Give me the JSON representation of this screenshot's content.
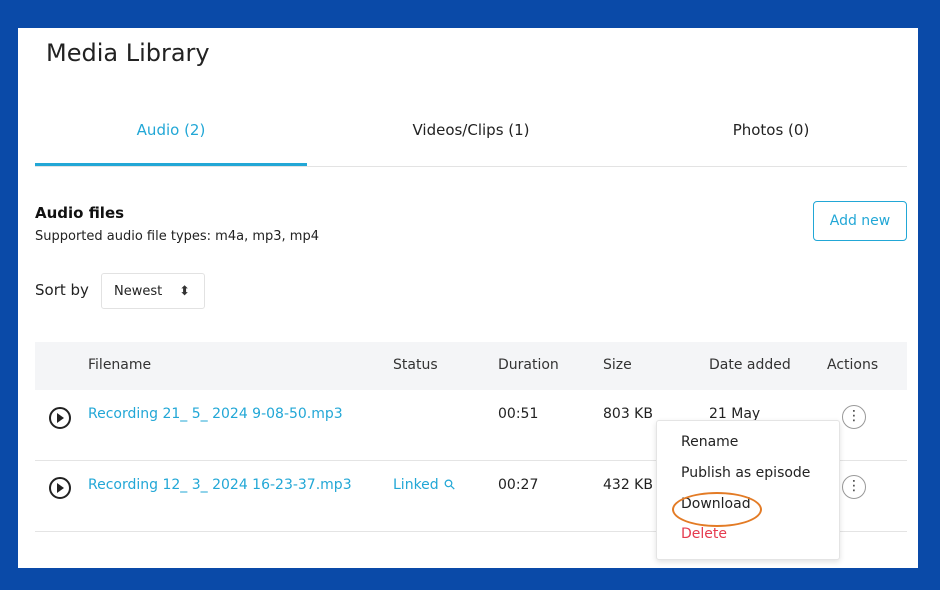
{
  "page": {
    "title": "Media Library"
  },
  "tabs": [
    {
      "label": "Audio (2)",
      "active": true
    },
    {
      "label": "Videos/Clips (1)",
      "active": false
    },
    {
      "label": "Photos (0)",
      "active": false
    }
  ],
  "section": {
    "title": "Audio files",
    "subtitle": "Supported audio file types: m4a, mp3, mp4",
    "add_button": "Add new"
  },
  "sort": {
    "label": "Sort by",
    "value": "Newest"
  },
  "table": {
    "headers": [
      "Filename",
      "Status",
      "Duration",
      "Size",
      "Date added",
      "Actions"
    ],
    "rows": [
      {
        "filename": "Recording 21_ 5_ 2024 9-08-50.mp3",
        "status": "",
        "duration": "00:51",
        "size": "803 KB",
        "date": "21 May"
      },
      {
        "filename": "Recording 12_ 3_ 2024 16-23-37.mp3",
        "status": "Linked",
        "duration": "00:27",
        "size": "432 KB",
        "date": ""
      }
    ]
  },
  "context_menu": {
    "items": [
      "Rename",
      "Publish as episode",
      "Download",
      "Delete"
    ],
    "highlighted": "Download"
  },
  "colors": {
    "accent": "#22a7d6",
    "frame": "#0a4aa8",
    "danger": "#e53a4e",
    "highlight": "#e37b25"
  },
  "icons": {
    "play": "play-circle-icon",
    "actions": "kebab-menu-icon",
    "link": "link-icon",
    "sort": "sort-caret-icon"
  }
}
